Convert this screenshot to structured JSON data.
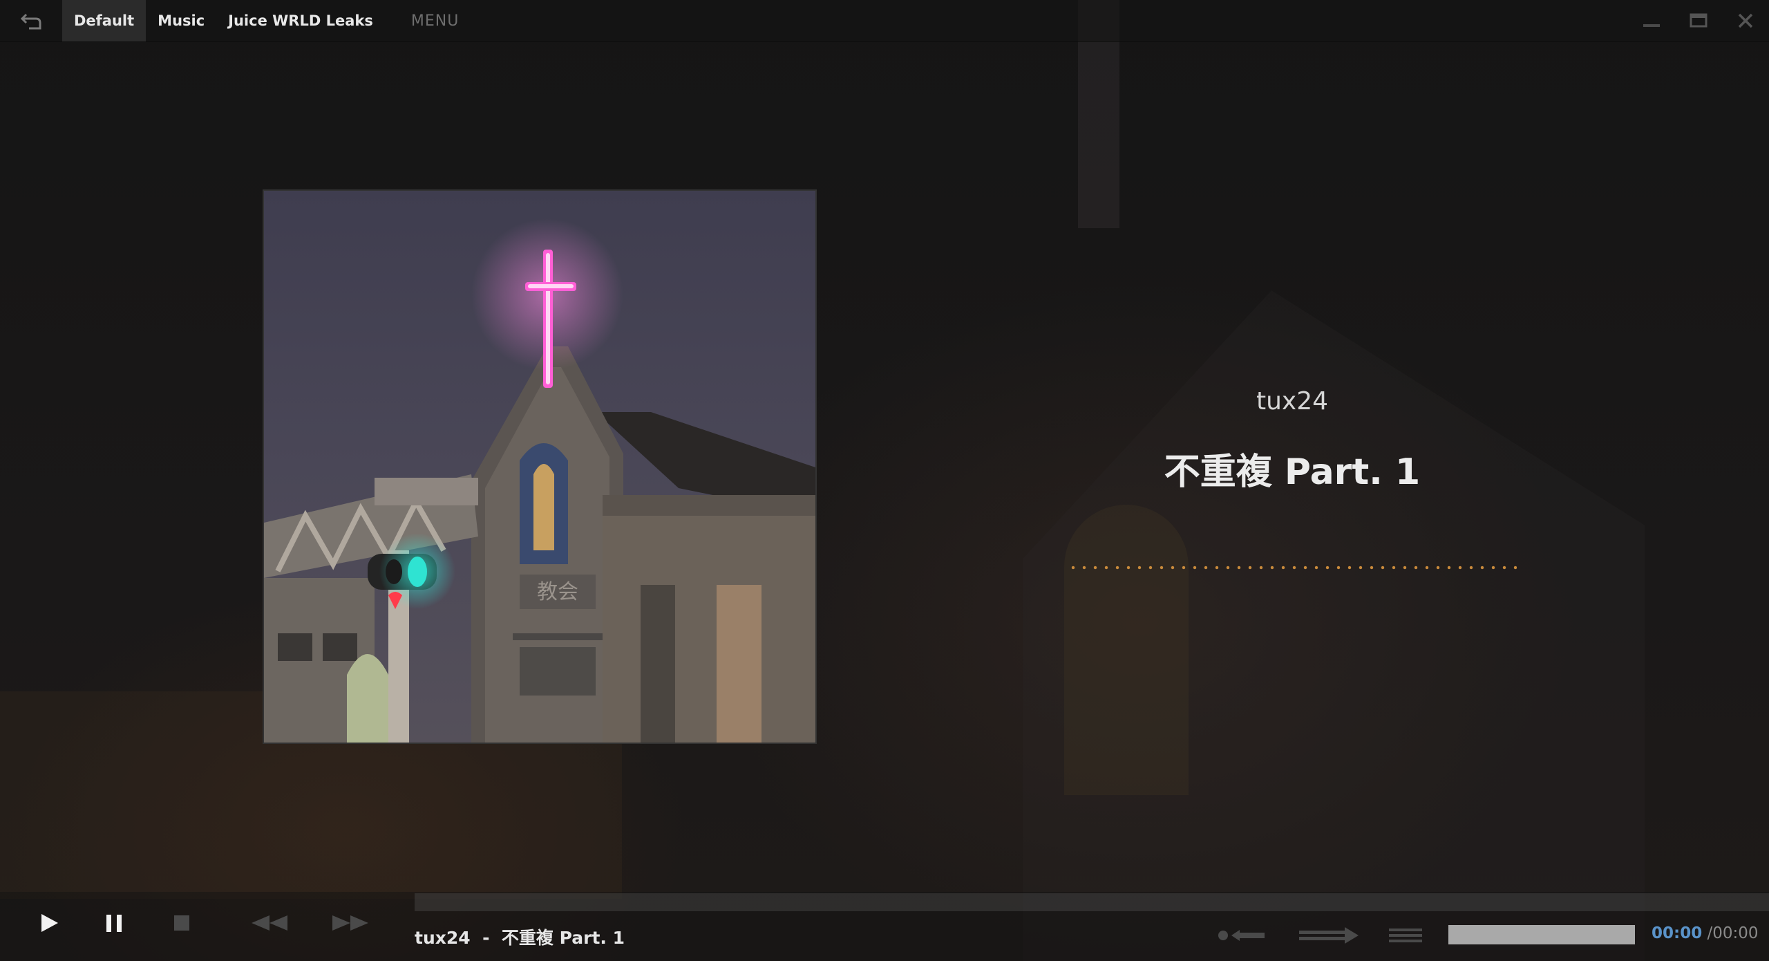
{
  "tabs": [
    {
      "label": "Default",
      "active": true
    },
    {
      "label": "Music",
      "active": false
    },
    {
      "label": "Juice WRLD Leaks",
      "active": false
    }
  ],
  "menu_label": "MENU",
  "window_controls": [
    "minimize-icon",
    "maximize-icon",
    "close-icon"
  ],
  "track": {
    "artist": "tux24",
    "title": "不重複 Part. 1",
    "now_playing_artist": "tux24",
    "now_playing_separator": "-",
    "now_playing_title": "不重複 Part. 1"
  },
  "artwork": {
    "sign_text": "教会"
  },
  "playback": {
    "current_time": "00:00",
    "time_separator": "/",
    "total_time": "00:00",
    "progress": 0
  },
  "controls": [
    "play-icon",
    "pause-icon",
    "stop-icon",
    "previous-icon",
    "next-icon",
    "repeat-icon",
    "shuffle-icon",
    "playlist-icon"
  ],
  "colors": {
    "accent_dots": "#c98a3b",
    "time_current": "#5a93c9",
    "neon_cross": "#ff6ad8",
    "traffic_light": "#2fe3d2"
  }
}
